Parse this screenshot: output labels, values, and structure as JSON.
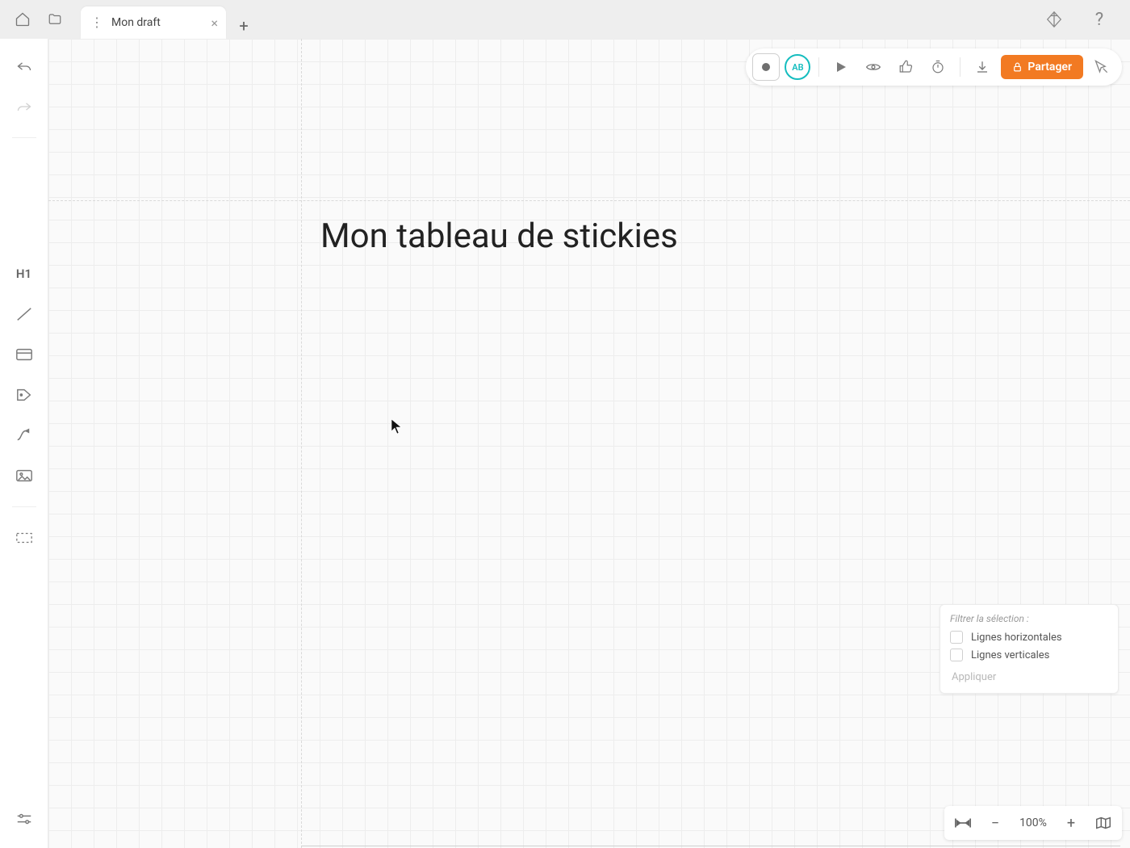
{
  "header": {
    "tab_title": "Mon draft",
    "avatar_initials": "AB",
    "share_label": "Partager"
  },
  "canvas": {
    "title": "Mon tableau de stickies"
  },
  "left_tools": {
    "h1_label": "H1"
  },
  "filter_panel": {
    "title": "Filtrer la sélection :",
    "option_horizontal": "Lignes horizontales",
    "option_vertical": "Lignes verticales",
    "apply_label": "Appliquer"
  },
  "zoom": {
    "level_label": "100%"
  }
}
